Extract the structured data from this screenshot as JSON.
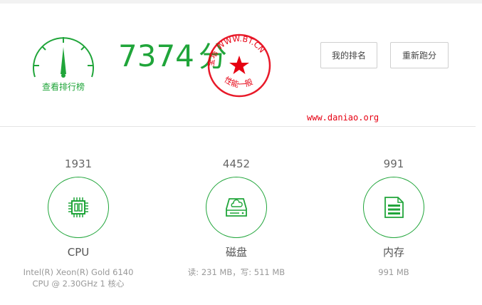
{
  "gauge": {
    "label": "查看排行榜"
  },
  "score": {
    "value": "7374",
    "unit": "分"
  },
  "stamp": {
    "top_text": "宝塔 WWW.BT.CN",
    "bottom_text": "性能一般"
  },
  "buttons": {
    "rank": "我的排名",
    "rerun": "重新跑分"
  },
  "watermark": "www.daniao.org",
  "metrics": [
    {
      "score": "1931",
      "name": "CPU",
      "desc": "Intel(R) Xeon(R) Gold 6140 CPU @ 2.30GHz 1 核心",
      "icon": "cpu-chip-icon"
    },
    {
      "score": "4452",
      "name": "磁盘",
      "desc": "读: 231 MB，写: 511 MB",
      "icon": "disk-cloud-icon"
    },
    {
      "score": "991",
      "name": "内存",
      "desc": "991 MB",
      "icon": "memory-doc-icon"
    }
  ],
  "colors": {
    "accent": "#20a53a",
    "stamp_red": "#e60012"
  }
}
